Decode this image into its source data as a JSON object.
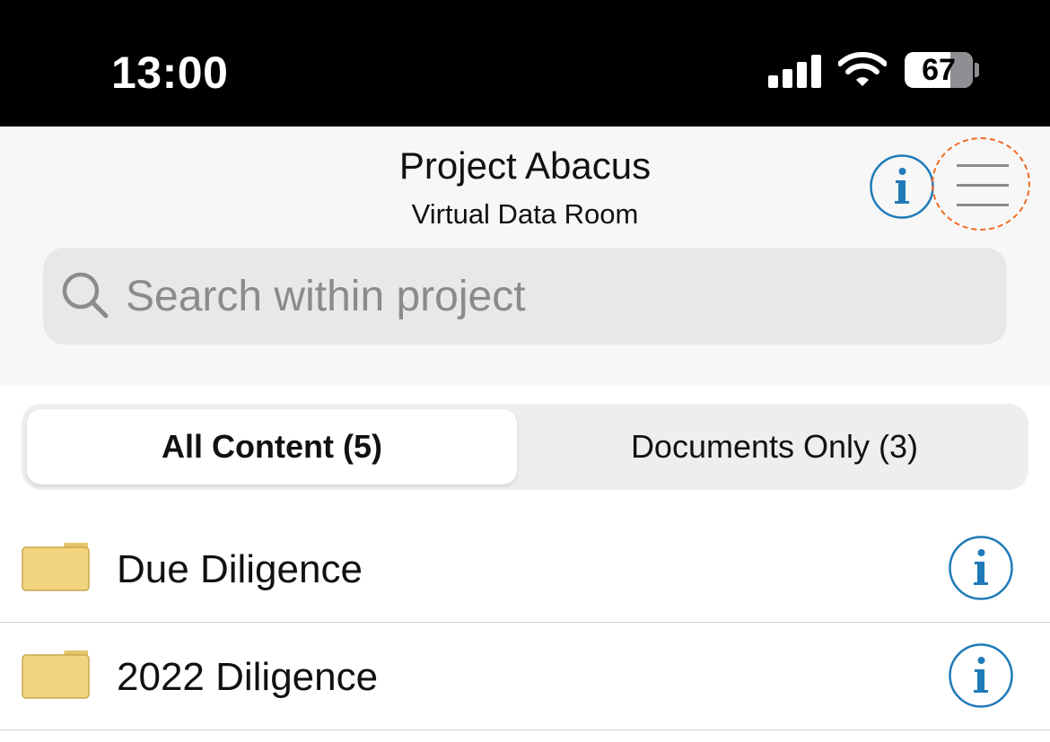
{
  "status_bar": {
    "time": "13:00",
    "battery_percent": "67",
    "battery_level": 0.67,
    "icons": [
      "signal-icon",
      "wifi-icon",
      "battery-icon"
    ]
  },
  "header": {
    "title": "Project Abacus",
    "subtitle": "Virtual Data Room",
    "info_icon": "info-icon",
    "menu_icon": "hamburger-menu-icon",
    "menu_highlight_color": "#f26b21"
  },
  "search": {
    "placeholder": "Search within project",
    "value": "",
    "icon": "search-icon"
  },
  "segmented": {
    "options": [
      {
        "label": "All Content (5)",
        "selected": true
      },
      {
        "label": "Documents Only (3)",
        "selected": false
      }
    ]
  },
  "list": {
    "items": [
      {
        "label": "Due Diligence",
        "icon": "folder-icon"
      },
      {
        "label": "2022 Diligence",
        "icon": "folder-icon"
      }
    ]
  },
  "colors": {
    "accent": "#1f7ab8",
    "folder": "#f2d57e",
    "folder_stroke": "#c9a84f",
    "status_bar_bg": "#000000",
    "header_bg": "#f7f7f7"
  }
}
